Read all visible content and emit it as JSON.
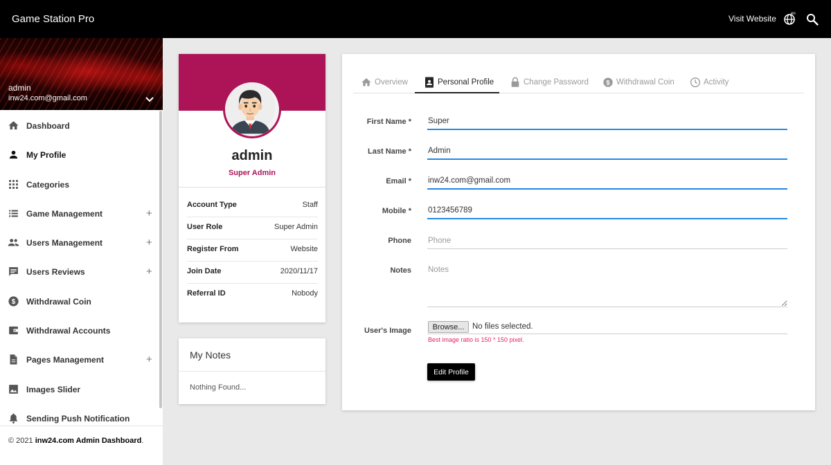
{
  "header": {
    "title": "Game Station Pro",
    "visit_label": "Visit Website",
    "lang_code": "en",
    "lang_icon": "globe-icon",
    "search_icon": "search-icon"
  },
  "sidebar": {
    "user_name": "admin",
    "user_email": "inw24.com@gmail.com",
    "items": [
      {
        "label": "Dashboard",
        "icon": "home-icon",
        "expandable": false
      },
      {
        "label": "My Profile",
        "icon": "person-icon",
        "expandable": false
      },
      {
        "label": "Categories",
        "icon": "grid-icon",
        "expandable": false
      },
      {
        "label": "Game Management",
        "icon": "list-icon",
        "expandable": true
      },
      {
        "label": "Users Management",
        "icon": "group-icon",
        "expandable": true
      },
      {
        "label": "Users Reviews",
        "icon": "comment-icon",
        "expandable": true
      },
      {
        "label": "Withdrawal Coin",
        "icon": "dollar-coin-icon",
        "expandable": false
      },
      {
        "label": "Withdrawal Accounts",
        "icon": "wallet-icon",
        "expandable": false
      },
      {
        "label": "Pages Management",
        "icon": "page-icon",
        "expandable": true
      },
      {
        "label": "Images Slider",
        "icon": "image-icon",
        "expandable": false
      },
      {
        "label": "Sending Push Notification",
        "icon": "bell-icon",
        "expandable": false
      }
    ],
    "plus_symbol": "+",
    "footer_prefix": "© 2021 ",
    "footer_brand": "inw24.com Admin Dashboard",
    "footer_suffix": "."
  },
  "profile_card": {
    "name": "admin",
    "role": "Super Admin",
    "rows": [
      {
        "key": "Account Type",
        "value": "Staff"
      },
      {
        "key": "User Role",
        "value": "Super Admin"
      },
      {
        "key": "Register From",
        "value": "Website"
      },
      {
        "key": "Join Date",
        "value": "2020/11/17"
      },
      {
        "key": "Referral ID",
        "value": "Nobody"
      }
    ]
  },
  "notes_card": {
    "title": "My Notes",
    "empty": "Nothing Found..."
  },
  "tabs": [
    {
      "label": "Overview",
      "icon": "home-icon",
      "active": false
    },
    {
      "label": "Personal Profile",
      "icon": "contact-card-icon",
      "active": true
    },
    {
      "label": "Change Password",
      "icon": "lock-icon",
      "active": false
    },
    {
      "label": "Withdrawal Coin",
      "icon": "dollar-coin-icon",
      "active": false
    },
    {
      "label": "Activity",
      "icon": "clock-icon",
      "active": false
    }
  ],
  "form": {
    "first_name": {
      "label": "First Name *",
      "value": "Super"
    },
    "last_name": {
      "label": "Last Name *",
      "value": "Admin"
    },
    "email": {
      "label": "Email *",
      "value": "inw24.com@gmail.com"
    },
    "mobile": {
      "label": "Mobile *",
      "value": "0123456789"
    },
    "phone": {
      "label": "Phone",
      "placeholder": "Phone"
    },
    "notes": {
      "label": "Notes",
      "placeholder": "Notes"
    },
    "image": {
      "label": "User's Image",
      "browse_label": "Browse...",
      "no_file": "No files selected.",
      "hint": "Best image ratio is 150 * 150 pixel."
    },
    "submit_label": "Edit Profile"
  },
  "colors": {
    "accent": "#ad1457",
    "focus": "#1e88e5",
    "hint": "#e91e63",
    "topbar": "#000000"
  }
}
